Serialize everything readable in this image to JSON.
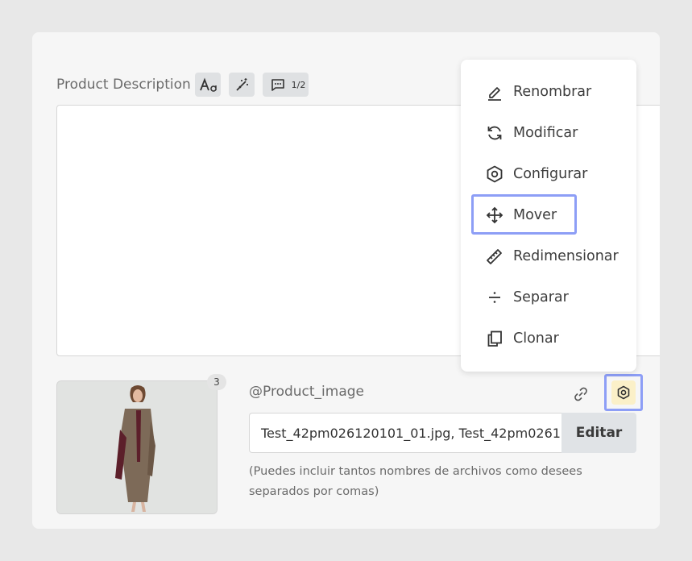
{
  "description": {
    "label": "Product Description",
    "counter": "1/2"
  },
  "image_field": {
    "badge_count": "3",
    "label": "@Product_image",
    "value": "Test_42pm026120101_01.jpg, Test_42pm0261",
    "edit_label": "Editar",
    "hint": "(Puedes incluir tantos nombres de archivos como desees separados por comas)"
  },
  "menu": {
    "items": [
      {
        "label": "Renombrar",
        "icon": "pencil-icon"
      },
      {
        "label": "Modificar",
        "icon": "refresh-icon"
      },
      {
        "label": "Configurar",
        "icon": "hexagon-settings-icon"
      },
      {
        "label": "Mover",
        "icon": "move-arrows-icon"
      },
      {
        "label": "Redimensionar",
        "icon": "ruler-icon"
      },
      {
        "label": "Separar",
        "icon": "divide-icon"
      },
      {
        "label": "Clonar",
        "icon": "copy-icon"
      }
    ]
  },
  "colors": {
    "highlight": "#8d9ef6",
    "cog_bg": "#fbf0c8",
    "tool_bg": "#dfe1e3"
  }
}
